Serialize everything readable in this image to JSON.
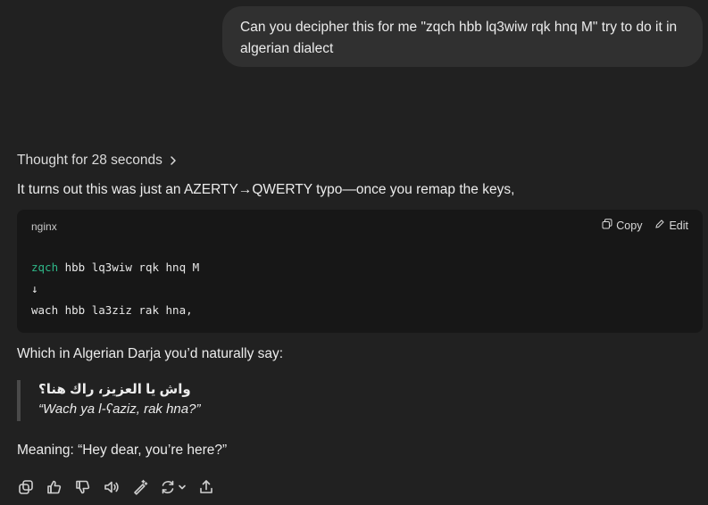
{
  "user_message": {
    "text": "Can you decipher this for me \"zqch hbb lq3wiw rqk hnq M\" try to do it in algerian dialect"
  },
  "assistant": {
    "thought_label": "Thought for 28 seconds",
    "intro": "It turns out this was just an AZERTY→QWERTY typo—once you remap the keys,",
    "code": {
      "language": "nginx",
      "copy_label": "Copy",
      "edit_label": "Edit",
      "line1_keyword": "zqch",
      "line1_rest": " hbb lq3wiw rqk hnq M",
      "line2": "↓",
      "line3": "wach hbb la3ziz rak hna,"
    },
    "para2": "Which in Algerian Darja you’d naturally say:",
    "quote": {
      "arabic": "واش يا العزيز، راك هنا؟",
      "transliteration": "“Wach ya l-ʕaziz, rak hna?”"
    },
    "meaning": "Meaning: “Hey dear, you’re here?”"
  },
  "toolbar": {
    "icons": [
      "copy-icon",
      "thumbs-up-icon",
      "thumbs-down-icon",
      "read-aloud-icon",
      "edit-magic-icon",
      "regenerate-icon",
      "share-icon"
    ]
  }
}
